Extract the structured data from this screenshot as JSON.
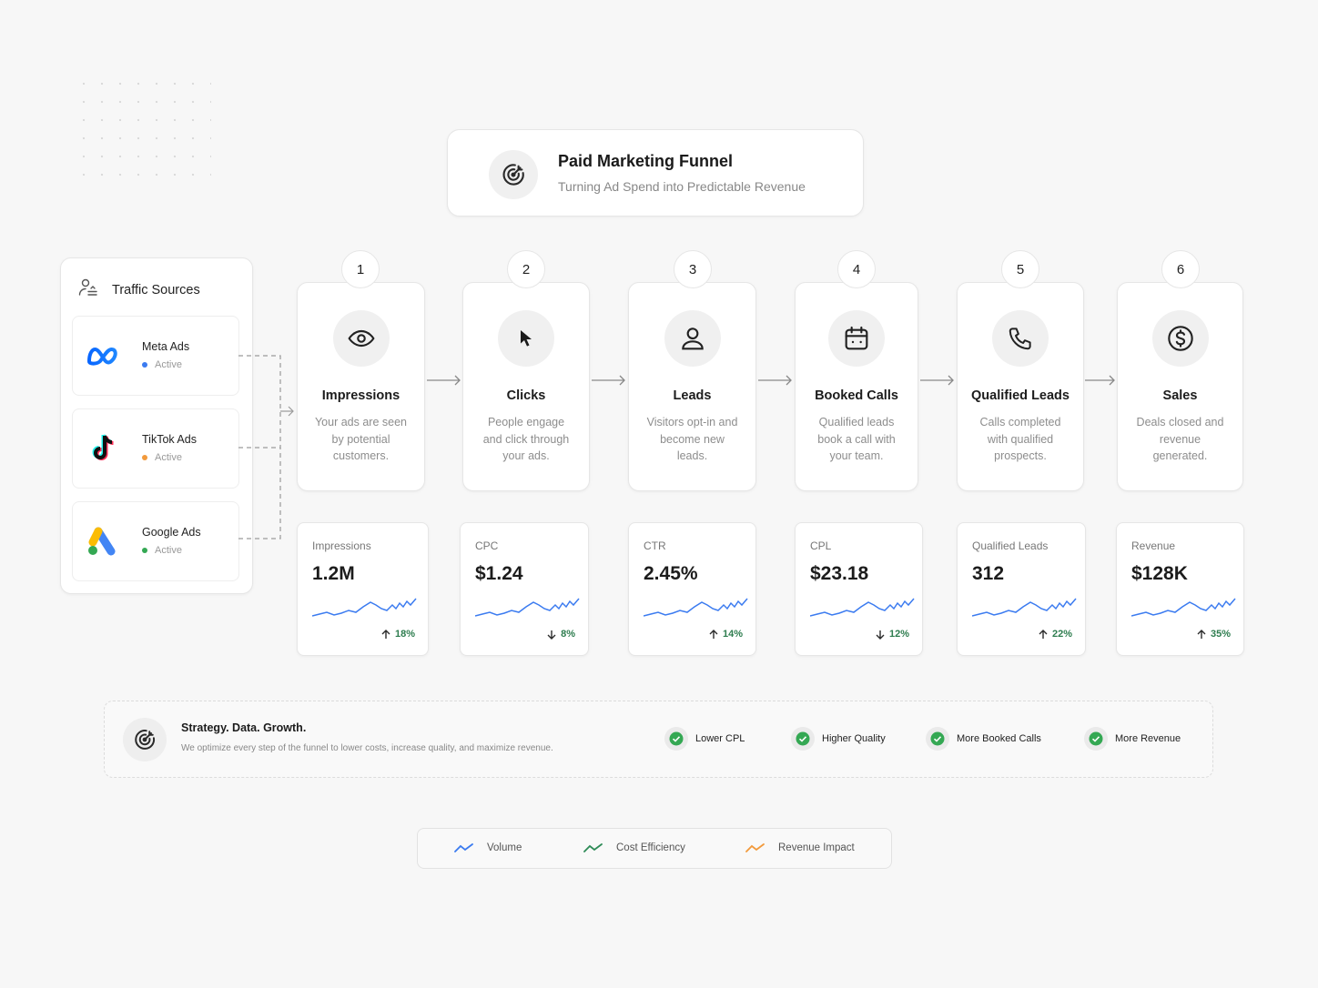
{
  "header": {
    "title": "Paid Marketing Funnel",
    "subtitle": "Turning Ad Spend into Predictable Revenue",
    "icon": "target-icon"
  },
  "sources": {
    "title": "Traffic Sources",
    "icon": "users-icon",
    "items": [
      {
        "name": "Meta Ads",
        "status": "Active",
        "status_color": "#3b7bf0",
        "icon": "meta-logo"
      },
      {
        "name": "TikTok Ads",
        "status": "Active",
        "status_color": "#f29a3c",
        "icon": "tiktok-logo"
      },
      {
        "name": "Google Ads",
        "status": "Active",
        "status_color": "#34a853",
        "icon": "google-ads-logo"
      }
    ]
  },
  "steps": [
    {
      "number": "1",
      "title": "Impressions",
      "desc": "Your ads are seen by potential customers.",
      "icon": "eye-icon"
    },
    {
      "number": "2",
      "title": "Clicks",
      "desc": "People engage and click through your ads.",
      "icon": "cursor-icon"
    },
    {
      "number": "3",
      "title": "Leads",
      "desc": "Visitors opt-in and become new leads.",
      "icon": "person-icon"
    },
    {
      "number": "4",
      "title": "Booked Calls",
      "desc": "Qualified leads book a call with your team.",
      "icon": "calendar-icon"
    },
    {
      "number": "5",
      "title": "Qualified Leads",
      "desc": "Calls completed with qualified prospects.",
      "icon": "phone-icon"
    },
    {
      "number": "6",
      "title": "Sales",
      "desc": "Deals closed and revenue generated.",
      "icon": "dollar-icon"
    }
  ],
  "metrics": [
    {
      "label": "Impressions",
      "value": "1.2M",
      "delta": "18%",
      "direction": "up"
    },
    {
      "label": "CPC",
      "value": "$1.24",
      "delta": "8%",
      "direction": "down"
    },
    {
      "label": "CTR",
      "value": "2.45%",
      "delta": "14%",
      "direction": "up"
    },
    {
      "label": "CPL",
      "value": "$23.18",
      "delta": "12%",
      "direction": "down"
    },
    {
      "label": "Qualified Leads",
      "value": "312",
      "delta": "22%",
      "direction": "up"
    },
    {
      "label": "Revenue",
      "value": "$128K",
      "delta": "35%",
      "direction": "up"
    }
  ],
  "strategy": {
    "title": "Strategy. Data. Growth.",
    "subtitle": "We optimize every step of the funnel to lower costs, increase quality, and maximize revenue.",
    "benefits": [
      "Lower CPL",
      "Higher Quality",
      "More Booked Calls",
      "More Revenue"
    ]
  },
  "legend": [
    {
      "label": "Volume",
      "color": "#3b7bf0"
    },
    {
      "label": "Cost Efficiency",
      "color": "#2e8b57"
    },
    {
      "label": "Revenue Impact",
      "color": "#f29a3c"
    }
  ],
  "colors": {
    "accent_blue": "#3b7bf0",
    "positive_green": "#2e7d4f",
    "check_green": "#34a853"
  }
}
